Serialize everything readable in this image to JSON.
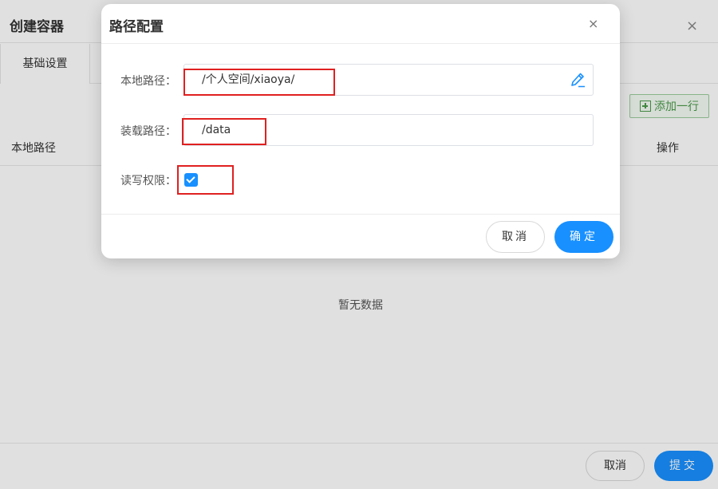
{
  "outer_dialog": {
    "title": "创建容器",
    "close_glyph": "×",
    "tabs": [
      {
        "label": "基础设置"
      }
    ],
    "add_row_label": "添加一行",
    "table": {
      "columns": [
        "本地路径",
        "操作"
      ],
      "empty_text": "暂无数据"
    },
    "footer": {
      "cancel_label": "取消",
      "submit_label": "提交"
    }
  },
  "path_dialog": {
    "title": "路径配置",
    "close_glyph": "×",
    "fields": {
      "local_path": {
        "label": "本地路径：",
        "value": "/个人空间/xiaoya/"
      },
      "mount_path": {
        "label": "装载路径：",
        "value": "/data"
      },
      "read_write": {
        "label": "读写权限：",
        "checked": true
      }
    },
    "footer": {
      "cancel_label": "取消",
      "confirm_label": "确定"
    }
  },
  "colors": {
    "primary": "#1890ff",
    "highlight": "#e02020",
    "add_button": "#4a9a4a"
  }
}
